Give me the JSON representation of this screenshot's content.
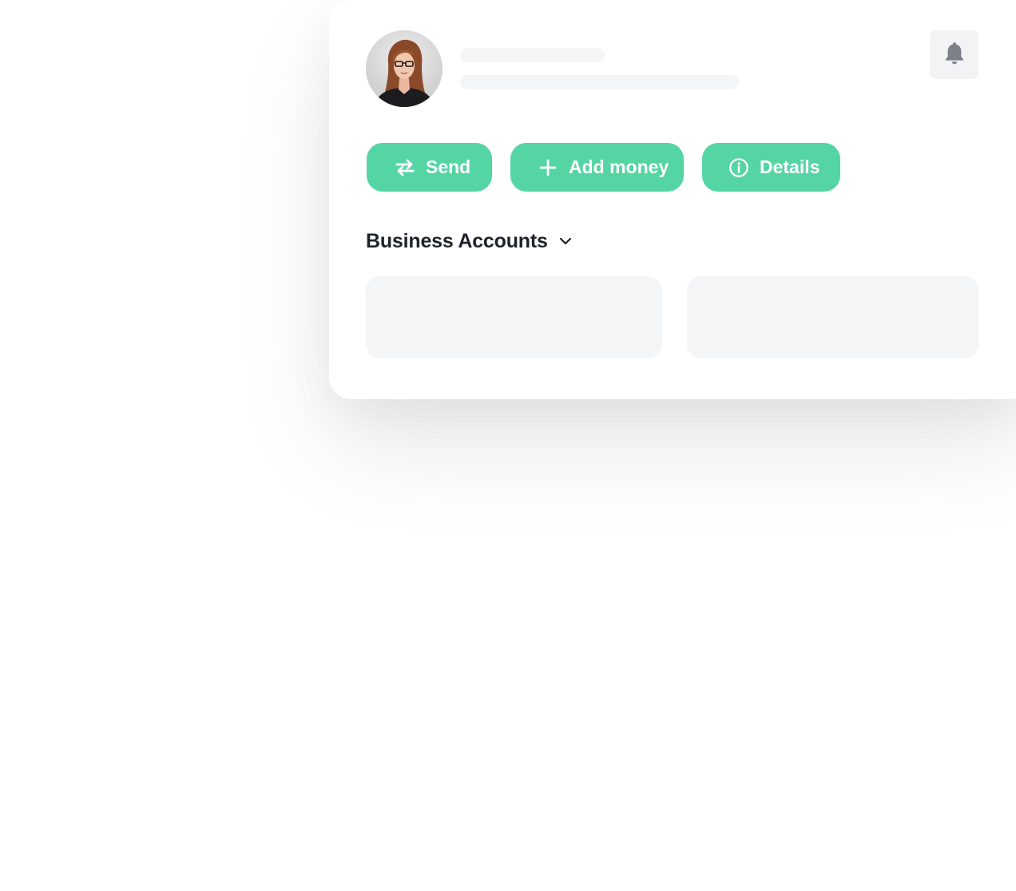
{
  "profile": {
    "avatar_alt": "User avatar"
  },
  "header": {
    "notifications_icon": "bell-icon"
  },
  "actions": [
    {
      "label": "Send",
      "icon": "transfer-arrows-icon"
    },
    {
      "label": "Add money",
      "icon": "plus-icon"
    },
    {
      "label": "Details",
      "icon": "info-icon"
    }
  ],
  "section": {
    "title": "Business Accounts",
    "icon": "chevron-down-icon"
  },
  "colors": {
    "accent": "#55d5a4",
    "skeleton": "#f4f5f7",
    "title": "#1f2228"
  }
}
